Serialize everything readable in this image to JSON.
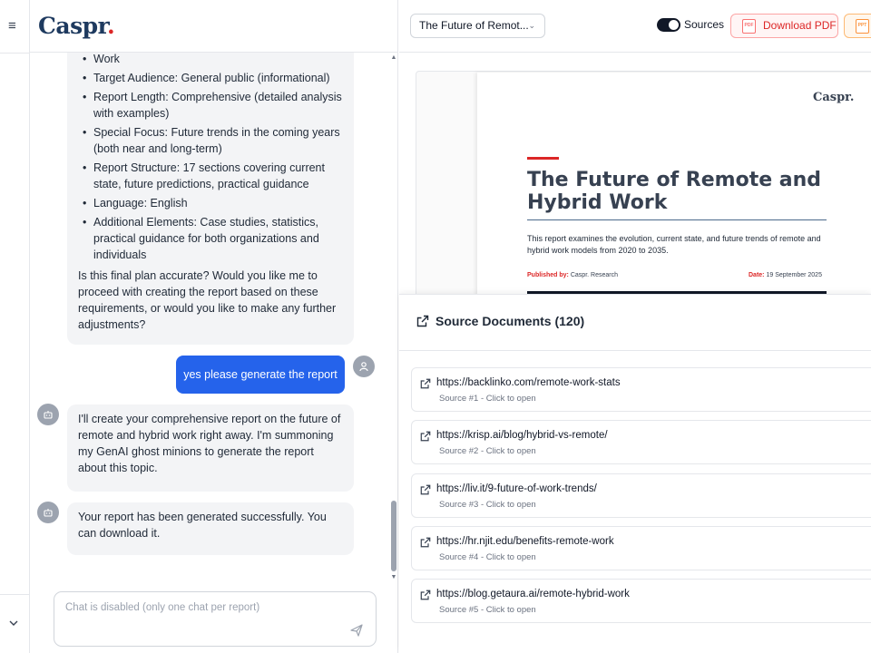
{
  "brand": {
    "name": "Caspr",
    "dot": "."
  },
  "chat": {
    "plan_items": [
      "Work",
      "Target Audience: General public (informational)",
      "Report Length: Comprehensive (detailed analysis with examples)",
      "Special Focus: Future trends in the coming years (both near and long-term)",
      "Report Structure: 17 sections covering current state, future predictions, practical guidance",
      "Language: English",
      "Additional Elements: Case studies, statistics, practical guidance for both organizations and individuals"
    ],
    "plan_question": "Is this final plan accurate? Would you like me to proceed with creating the report based on these requirements, or would you like to make any further adjustments?",
    "user_message": "yes please generate the report",
    "ai_message_1": "I'll create your comprehensive report on the future of remote and hybrid work right away. I'm summoning my GenAI ghost minions to generate the report about this topic.",
    "ai_message_2": "Your report has been generated successfully. You can download it.",
    "input_placeholder": "Chat is disabled (only one chat per report)"
  },
  "toolbar": {
    "report_select": "The Future of Remot...",
    "sources_toggle_label": "Sources",
    "sources_toggle_on": true,
    "download_pdf_label": "Download PDF"
  },
  "report_preview": {
    "logo": "Caspr.",
    "title": "The Future of Remote and Hybrid Work",
    "description": "This report examines the evolution, current state, and future trends of remote and hybrid work models from 2020 to 2035.",
    "published_by_label": "Published by:",
    "published_by": "Caspr. Research",
    "date_label": "Date:",
    "date": "19 September 2025"
  },
  "sources": {
    "title": "Source Documents (120)",
    "items": [
      {
        "url": "https://backlinko.com/remote-work-stats",
        "sub": "Source #1 - Click to open"
      },
      {
        "url": "https://krisp.ai/blog/hybrid-vs-remote/",
        "sub": "Source #2 - Click to open"
      },
      {
        "url": "https://liv.it/9-future-of-work-trends/",
        "sub": "Source #3 - Click to open"
      },
      {
        "url": "https://hr.njit.edu/benefits-remote-work",
        "sub": "Source #4 - Click to open"
      },
      {
        "url": "https://blog.getaura.ai/remote-hybrid-work",
        "sub": "Source #5 - Click to open"
      }
    ]
  }
}
